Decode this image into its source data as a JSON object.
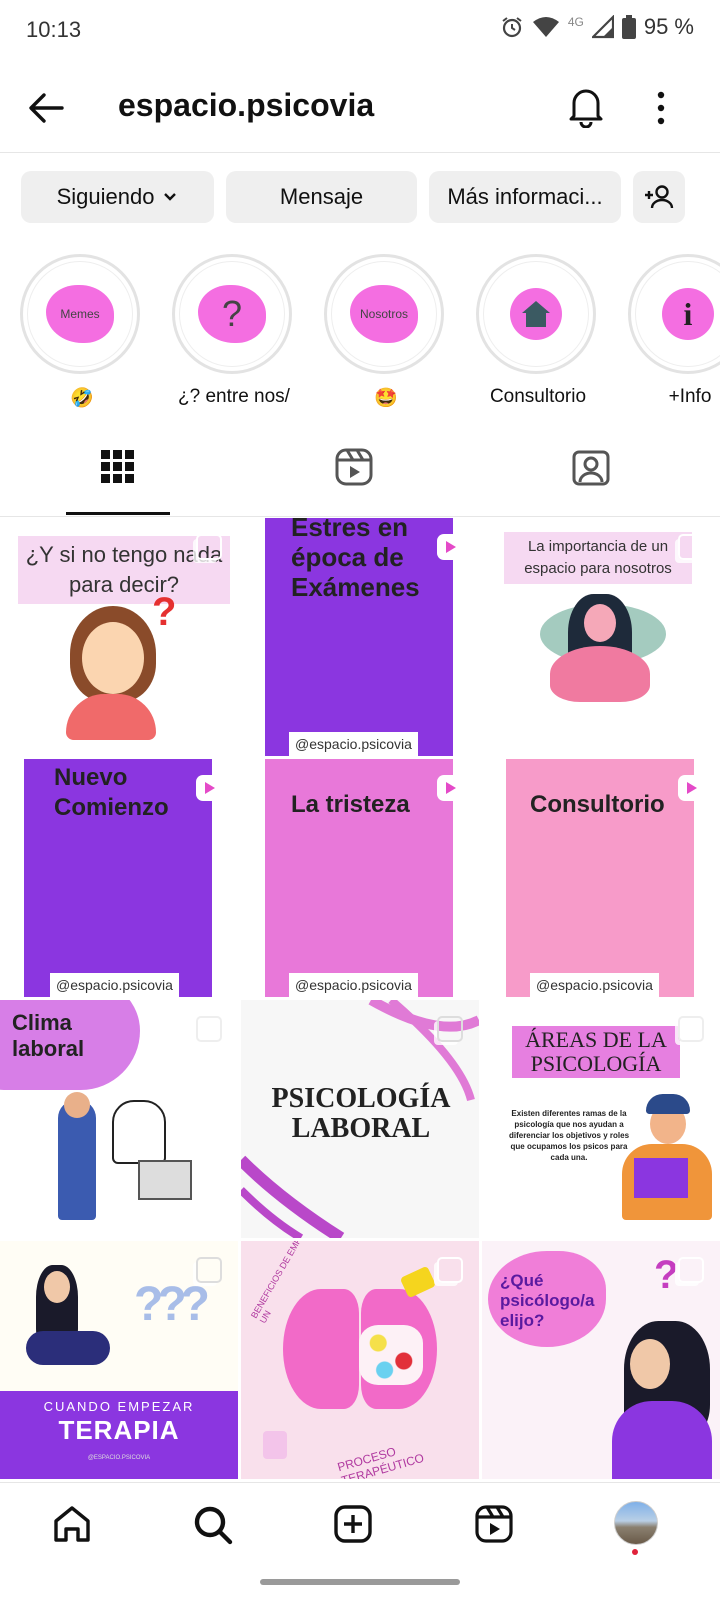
{
  "status_bar": {
    "time": "10:13",
    "network": "4G",
    "battery": "95 %"
  },
  "header": {
    "title": "espacio.psicovia"
  },
  "actions": {
    "following": "Siguiendo",
    "message": "Mensaje",
    "more_info": "Más informaci..."
  },
  "highlights": [
    {
      "label": "🤣",
      "cover": "Memes"
    },
    {
      "label": "¿? entre nos/",
      "cover": "?"
    },
    {
      "label": "🤩",
      "cover": "Nosotros"
    },
    {
      "label": "Consultorio",
      "cover": ""
    },
    {
      "label": "+Info",
      "cover": "i"
    }
  ],
  "posts": [
    {
      "text": "¿Y si no tengo nada para decir?"
    },
    {
      "text": "Estres en época de Exámenes",
      "handle": "@espacio.psicovia"
    },
    {
      "text": "La importancia de un espacio para nosotros"
    },
    {
      "text": "Nuevo Comienzo",
      "handle": "@espacio.psicovia"
    },
    {
      "text": "La tristeza",
      "handle": "@espacio.psicovia"
    },
    {
      "text": "Consultorio",
      "handle": "@espacio.psicovia"
    },
    {
      "text": "Clima laboral"
    },
    {
      "text": "PSICOLOGÍA LABORAL"
    },
    {
      "title": "ÁREAS DE LA PSICOLOGÍA",
      "body": "Existen diferentes ramas de la psicología que nos ayudan a diferenciar los objetivos y roles que ocupamos los psicos para cada una."
    },
    {
      "text_small": "CUANDO EMPEZAR",
      "text_big": "TERAPIA",
      "handle": "@ESPACIO.PSICOVIA"
    },
    {
      "text_top": "BENEFICIOS DE EMPEZAR UN",
      "text_bottom": "PROCESO TERAPÉUTICO"
    },
    {
      "text": "¿Qué psicólogo/a elijo?"
    }
  ],
  "colors": {
    "purple": "#8b36e0",
    "pink": "#e878d9",
    "light_pink": "#f79bc9",
    "accent": "#f46ee1"
  }
}
